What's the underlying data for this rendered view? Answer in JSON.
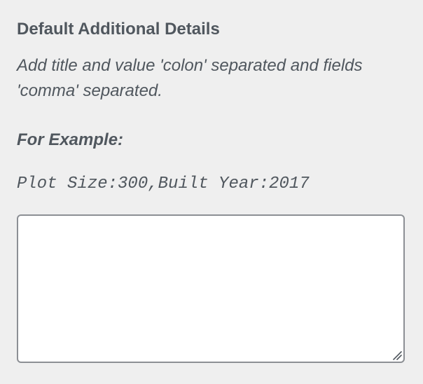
{
  "section": {
    "title": "Default Additional Details",
    "description": "Add title and value 'colon' separated and fields 'comma' separated.",
    "example_label": "For Example:",
    "example_text": "Plot Size:300,Built Year:2017"
  },
  "textarea": {
    "value": "",
    "placeholder": ""
  },
  "icons": {
    "resize_grip": "resize-grip-icon"
  },
  "colors": {
    "background": "#efefef",
    "text": "#50575e",
    "input_border": "#8c8f94",
    "input_background": "#ffffff"
  }
}
